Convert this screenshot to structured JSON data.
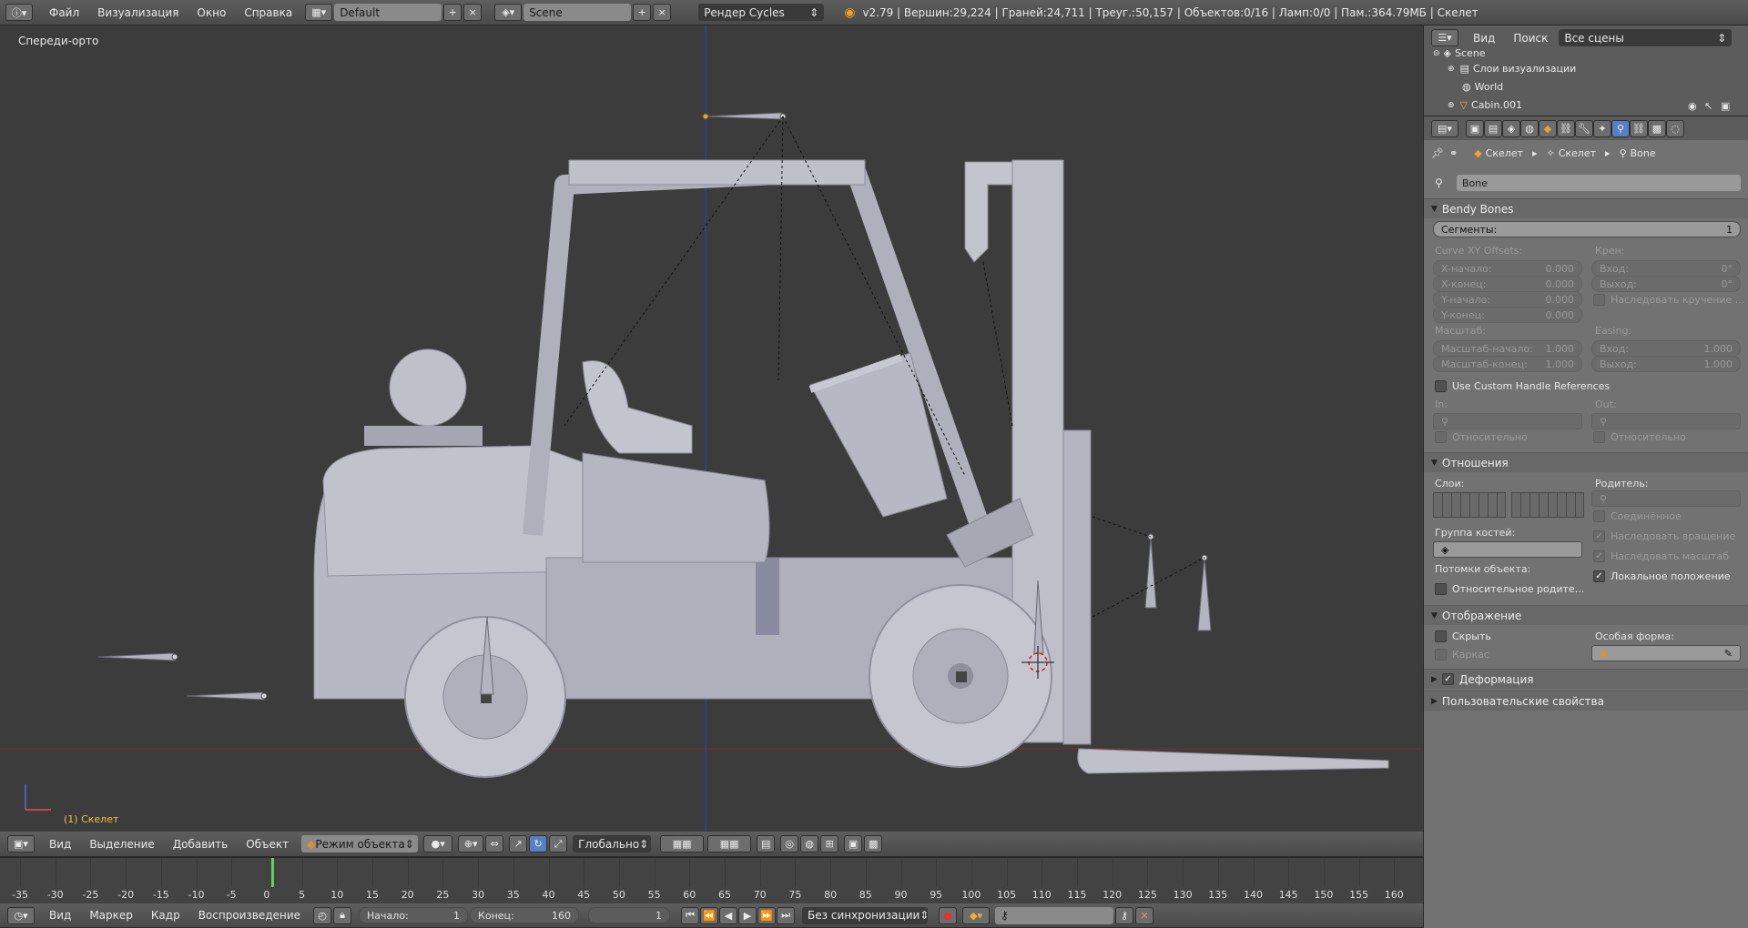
{
  "top_menu": {
    "items": [
      "Файл",
      "Визуализация",
      "Окно",
      "Справка"
    ],
    "layout": "Default",
    "scene": "Scene",
    "render_engine": "Рендер Cycles",
    "stats": "v2.79 | Вершин:29,224 | Граней:24,711 | Треуг.:50,157 | Объектов:0/16 | Ламп:0/0 | Пам.:364.79МБ | Скелет"
  },
  "viewport": {
    "view_name": "Спереди-орто",
    "object_label": "(1) Скелет"
  },
  "outliner": {
    "menu": [
      "Вид",
      "Поиск"
    ],
    "scope": "Все сцены",
    "tree": [
      "Scene",
      "Слои визуализации",
      "World",
      "Cabin.001"
    ]
  },
  "properties": {
    "breadcrumb": [
      "Скелет",
      "Скелет",
      "Bone"
    ],
    "bone_name": "Bone",
    "bendy": {
      "title": "Bendy Bones",
      "segments_label": "Сегменты:",
      "segments_value": "1",
      "curve_offsets_label": "Curve XY Offsets:",
      "offsets": [
        {
          "label": "X-начало:",
          "value": "0.000"
        },
        {
          "label": "X-конец:",
          "value": "0.000"
        },
        {
          "label": "Y-начало:",
          "value": "0.000"
        },
        {
          "label": "Y-конец:",
          "value": "0.000"
        }
      ],
      "roll_label": "Крен:",
      "roll": [
        {
          "label": "Вход:",
          "value": "0°"
        },
        {
          "label": "Выход:",
          "value": "0°"
        }
      ],
      "inherit_roll": "Наследовать кручение ...",
      "scale_label": "Масштаб:",
      "scale": [
        {
          "label": "Масштаб-начало:",
          "value": "1.000"
        },
        {
          "label": "Масштаб-конец:",
          "value": "1.000"
        }
      ],
      "easing_label": "Easing:",
      "easing": [
        {
          "label": "Вход:",
          "value": "1.000"
        },
        {
          "label": "Выход:",
          "value": "1.000"
        }
      ],
      "custom_handles": "Use Custom Handle References",
      "in_label": "In:",
      "out_label": "Out:",
      "relative": "Относительно"
    },
    "relations": {
      "title": "Отношения",
      "layers_label": "Слои:",
      "parent_label": "Родитель:",
      "connected": "Соединённое",
      "inherit_rotation": "Наследовать вращение",
      "inherit_scale": "Наследовать масштаб",
      "local_location": "Локальное положение",
      "bone_group_label": "Группа костей:",
      "object_children_label": "Потомки объекта:",
      "relative_parent": "Относительное родите..."
    },
    "display": {
      "title": "Отображение",
      "hide": "Скрыть",
      "wire": "Каркас",
      "custom_shape_label": "Особая форма:"
    },
    "deform": "Деформация",
    "custom_props": "Пользовательские свойства"
  },
  "viewport_header": {
    "menu": [
      "Вид",
      "Выделение",
      "Добавить",
      "Объект"
    ],
    "mode": "Режим объекта",
    "orientation": "Глобально"
  },
  "timeline": {
    "ticks": [
      "-35",
      "-30",
      "-25",
      "-20",
      "-15",
      "-10",
      "-5",
      "0",
      "5",
      "10",
      "15",
      "20",
      "25",
      "30",
      "35",
      "40",
      "45",
      "50",
      "55",
      "60",
      "65",
      "70",
      "75",
      "80",
      "85",
      "90",
      "95",
      "100",
      "105",
      "110",
      "115",
      "120",
      "125",
      "130",
      "135",
      "140",
      "145",
      "150",
      "155",
      "160"
    ],
    "current_frame_marker": 1
  },
  "timeline_footer": {
    "menu": [
      "Вид",
      "Маркер",
      "Кадр",
      "Воспроизведение"
    ],
    "start_label": "Начало:",
    "start_value": "1",
    "end_label": "Конец:",
    "end_value": "160",
    "current": "1",
    "sync": "Без синхронизации"
  }
}
